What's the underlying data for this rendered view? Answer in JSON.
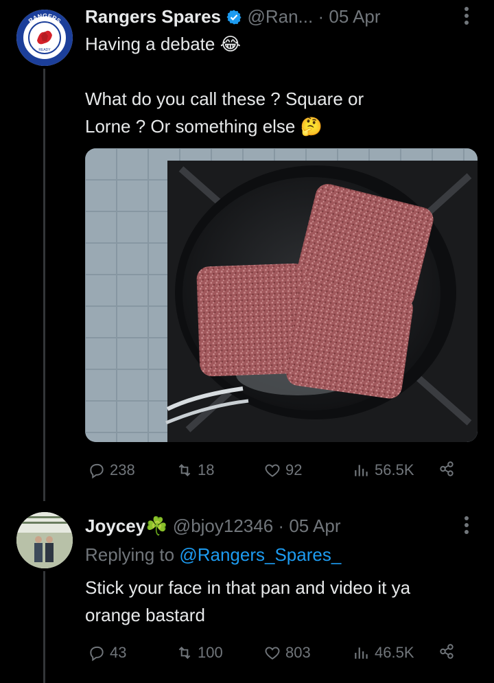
{
  "tweet": {
    "name": "Rangers Spares",
    "handle": "@Ran...",
    "dot": "·",
    "date": "05 Apr",
    "line1": "Having a debate 😂",
    "line2": "What do you call these ? Square or",
    "line3": "Lorne ? Or something else 🤔",
    "avatar_text_top": "RANGERS",
    "avatar_text_bottom": "FOOTBALL CLUB",
    "avatar_text_small": "READY",
    "stats": {
      "replies": "238",
      "retweets": "18",
      "likes": "92",
      "views": "56.5K"
    }
  },
  "reply": {
    "name": "Joycey",
    "emoji": "☘️",
    "handle": "@bjoy12346",
    "dot": "·",
    "date": "05 Apr",
    "replying_prefix": "Replying to",
    "replying_to": "@Rangers_Spares_",
    "line1": "Stick your face in that pan and video it ya",
    "line2": "orange bastard",
    "stats": {
      "replies": "43",
      "retweets": "100",
      "likes": "803",
      "views": "46.5K"
    }
  },
  "colors": {
    "background": "#000000",
    "text": "#e7e9ea",
    "muted": "#71767b",
    "link": "#1d9bf0",
    "verified": "#1d9bf0",
    "rangers_blue": "#1c3f9a",
    "rangers_red": "#d4212a"
  },
  "icons": [
    "more-icon",
    "verified-icon",
    "reply-icon",
    "retweet-icon",
    "like-icon",
    "views-icon",
    "share-icon"
  ]
}
